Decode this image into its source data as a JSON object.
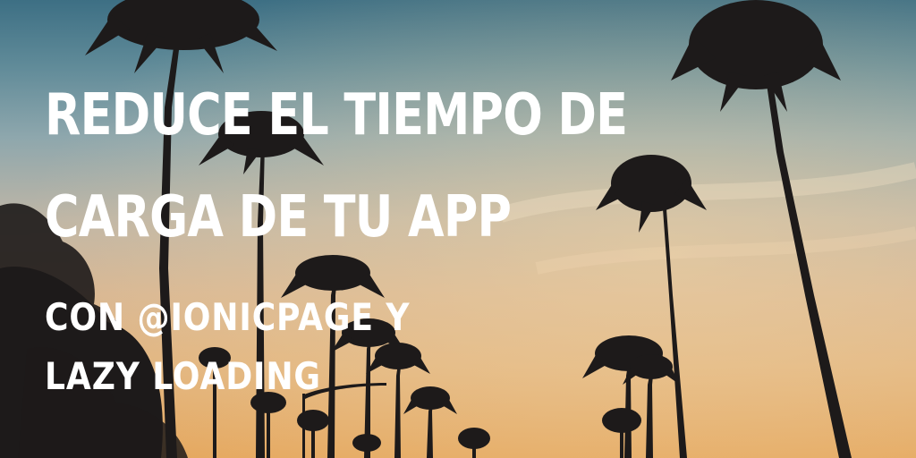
{
  "headline": {
    "line1": "REDUCE EL TIEMPO DE",
    "line2": "CARGA DE TU APP"
  },
  "subline": {
    "line1": "CON @IONICPAGE Y",
    "line2": "LAZY LOADING"
  },
  "background": {
    "sky_colors": [
      "#3d6f84",
      "#8ea7ad",
      "#d8b793",
      "#e5a85f"
    ],
    "silhouette_color": "#1d1a1a"
  }
}
